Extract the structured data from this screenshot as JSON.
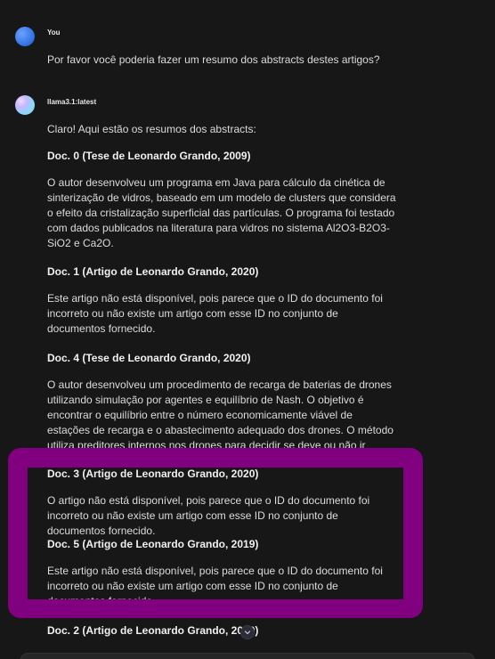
{
  "user": {
    "name": "You",
    "message": "Por favor você poderia fazer um resumo dos abstracts destes artigos?"
  },
  "assistant": {
    "name": "llama3.1:latest",
    "intro": "Claro! Aqui estão os resumos dos abstracts:",
    "docs": [
      {
        "heading": "Doc. 0 (Tese de Leonardo Grando, 2009)",
        "body": "O autor desenvolveu um programa em Java para cálculo da cinética de sinterização de vidros, baseado em um modelo de clusters que considera o efeito da cristalização superficial das partículas. O programa foi testado com dados publicados na literatura para vidros no sistema Al2O3-B2O3-SiO2 e Ca2O."
      },
      {
        "heading": "Doc. 1 (Artigo de Leonardo Grando, 2020)",
        "body": "Este artigo não está disponível, pois parece que o ID do documento foi incorreto ou não existe um artigo com esse ID no conjunto de documentos fornecido."
      },
      {
        "heading": "Doc. 4 (Tese de Leonardo Grando, 2020)",
        "body": "O autor desenvolveu um procedimento de recarga de baterias de drones utilizando simulação por agentes e equilíbrio de Nash. O objetivo é encontrar o equilíbrio entre o número economicamente viável de estações de recarga e o abastecimento adequado dos drones. O método utiliza preditores internos nos drones para decidir se deve ou não ir abastecer."
      },
      {
        "heading": "Doc. 3 (Artigo de Leonardo Grando, 2020)",
        "body": "O artigo não está disponível, pois parece que o ID do documento foi incorreto ou não existe um artigo com esse ID no conjunto de documentos fornecido."
      },
      {
        "heading": "Doc. 5 (Artigo de Leonardo Grando, 2019)",
        "body": "Este artigo não está disponível, pois parece que o ID do documento foi incorreto ou não existe um artigo com esse ID no conjunto de documentos fornecido."
      },
      {
        "heading": "Doc. 2 (Artigo de Leonardo Grando, 2020)",
        "body": ""
      }
    ]
  },
  "colors": {
    "background": "#171717",
    "highlight_frame": "#800080"
  },
  "icons": {
    "scroll_down": "chevron-down-icon"
  }
}
